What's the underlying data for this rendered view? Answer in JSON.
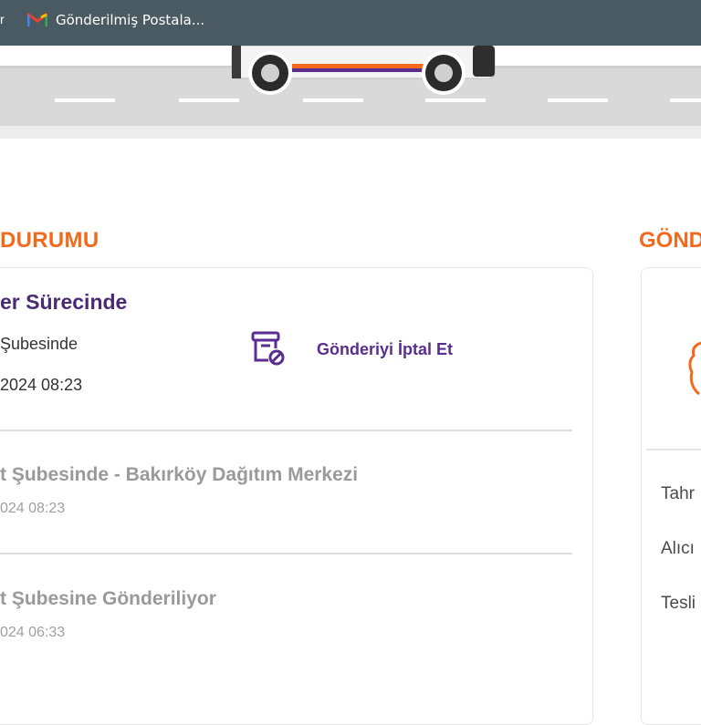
{
  "bookmarks": {
    "prev_fragment": "r",
    "item_label": "Gönderilmiş Postala..."
  },
  "tracking": {
    "section_title": "DURUMU",
    "right_section_title": "GÖND",
    "current_status": "er Sürecinde",
    "current_location": "Şubesinde",
    "current_datetime": "2024 08:23",
    "cancel_label": "Gönderiyi İptal Et",
    "history": [
      {
        "title": "t Şubesinde - Bakırköy Dağıtım Merkezi",
        "date": "024 08:23"
      },
      {
        "title": "t Şubesine Gönderiliyor",
        "date": "024 06:33"
      }
    ]
  },
  "side_panel": {
    "labels": [
      "Tahr",
      "Alıcı",
      "Tesli"
    ]
  },
  "colors": {
    "accent_orange": "#f26b1d",
    "brand_purple": "#4b2a74",
    "bookmark_bar": "#4a5a63"
  },
  "icons": [
    "gmail-icon",
    "cancel-shipment-icon",
    "van-illustration",
    "hand-icon"
  ]
}
